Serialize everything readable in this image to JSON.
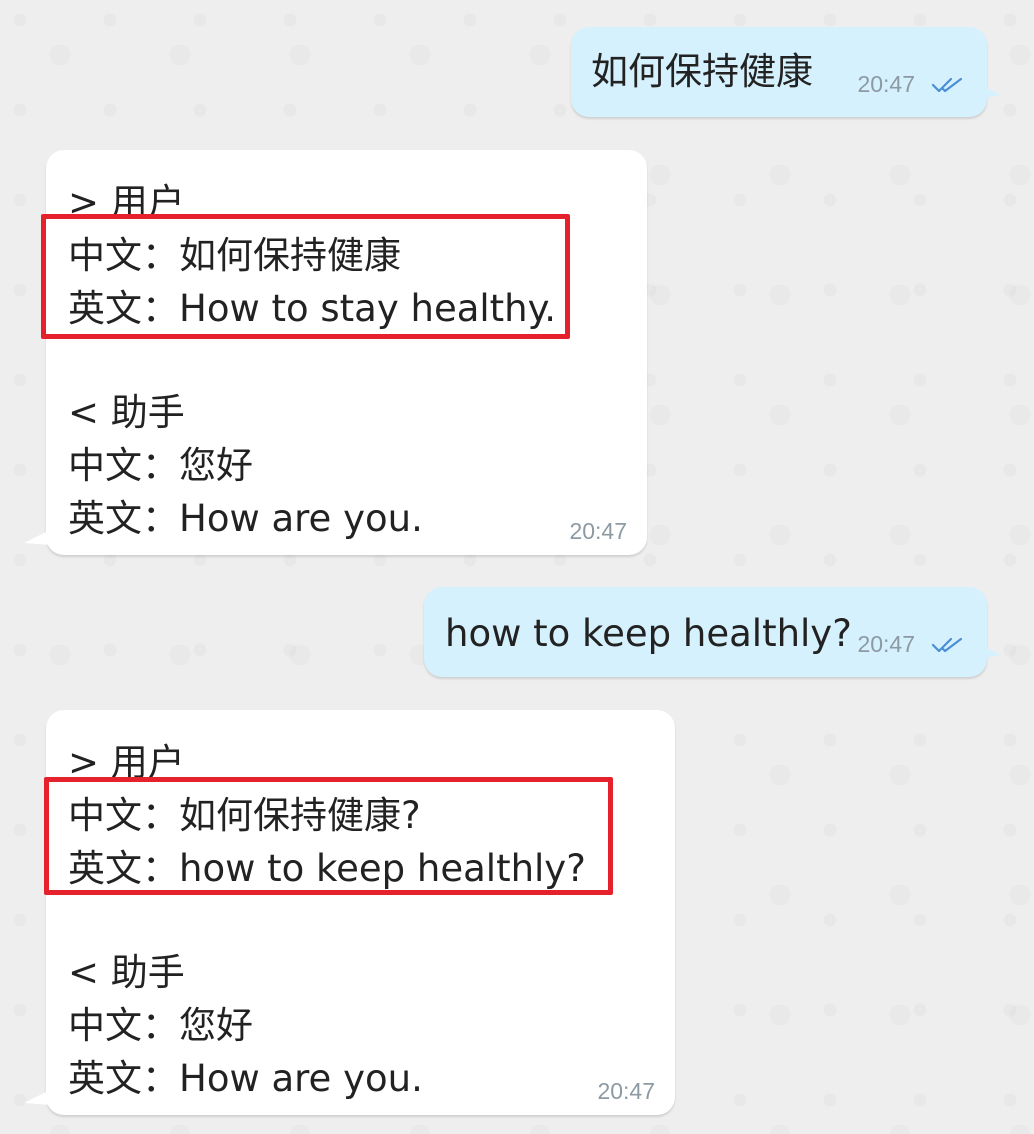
{
  "messages": [
    {
      "direction": "outgoing",
      "text": "如何保持健康",
      "time": "20:47",
      "status": "read-double-check-icon"
    },
    {
      "direction": "incoming",
      "lines": [
        "> 用户",
        "中文：如何保持健康",
        "英文：How to stay healthy.",
        "",
        "< 助手",
        "中文：您好",
        "英文：How are you."
      ],
      "time": "20:47"
    },
    {
      "direction": "outgoing",
      "text": "how to keep healthly?",
      "time": "20:47",
      "status": "read-double-check-icon"
    },
    {
      "direction": "incoming",
      "lines": [
        "> 用户",
        "中文：如何保持健康?",
        "英文：how to keep healthly?",
        "",
        "< 助手",
        "中文：您好",
        "英文：How are you."
      ],
      "time": "20:47"
    }
  ],
  "colors": {
    "outgoing_bubble": "#d5f1fd",
    "incoming_bubble": "#ffffff",
    "highlight_box": "#e5212b",
    "read_check": "#4a8fd6",
    "time_text": "#8c9aa3"
  }
}
